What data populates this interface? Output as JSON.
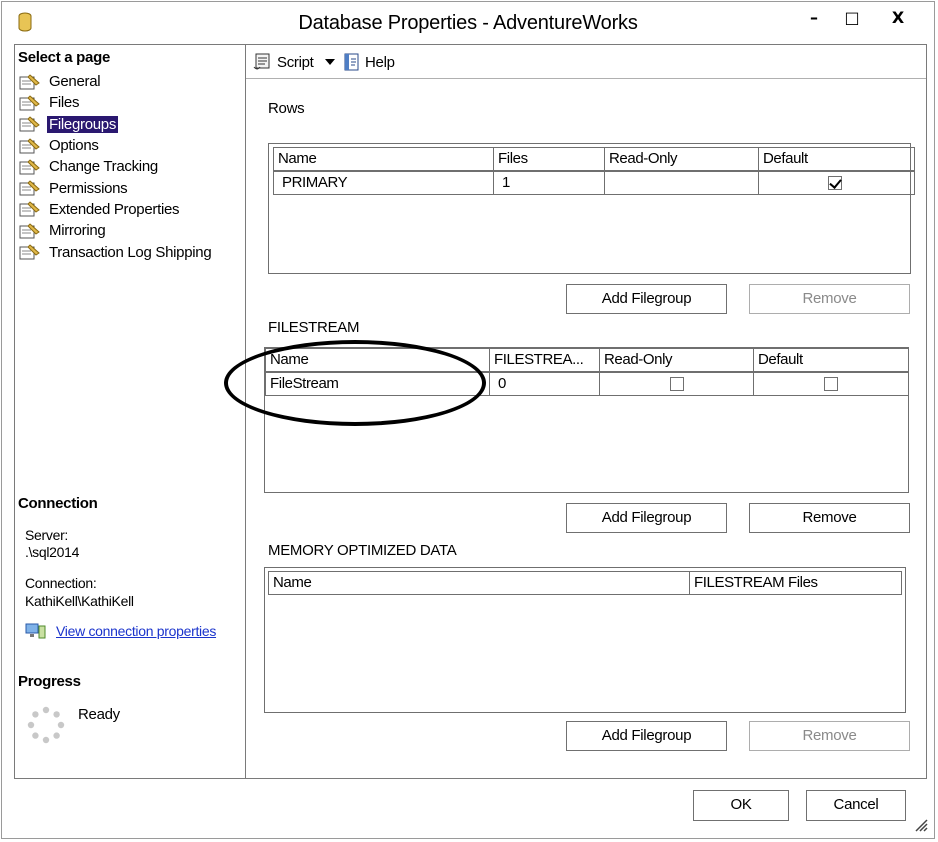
{
  "window": {
    "title": "Database Properties - AdventureWorks",
    "minimize_glyph": "–",
    "maximize_glyph": "□",
    "close_glyph": "X"
  },
  "left": {
    "select_page_heading": "Select a page",
    "pages": [
      {
        "label": "General",
        "selected": false
      },
      {
        "label": "Files",
        "selected": false
      },
      {
        "label": "Filegroups",
        "selected": true
      },
      {
        "label": "Options",
        "selected": false
      },
      {
        "label": "Change Tracking",
        "selected": false
      },
      {
        "label": "Permissions",
        "selected": false
      },
      {
        "label": "Extended Properties",
        "selected": false
      },
      {
        "label": "Mirroring",
        "selected": false
      },
      {
        "label": "Transaction Log Shipping",
        "selected": false
      }
    ],
    "connection_heading": "Connection",
    "server_label": "Server:",
    "server_value": ".\\sql2014",
    "connection_label": "Connection:",
    "connection_value": "KathiKell\\KathiKell",
    "view_connection_link": "View connection properties",
    "progress_heading": "Progress",
    "progress_status": "Ready"
  },
  "toolbar": {
    "script_label": "Script",
    "help_label": "Help"
  },
  "rows": {
    "heading": "Rows",
    "columns": [
      "Name",
      "Files",
      "Read-Only",
      "Default"
    ],
    "items": [
      {
        "name": "PRIMARY",
        "files": "1",
        "read_only": false,
        "default": true
      }
    ],
    "add_button": "Add Filegroup",
    "remove_button": "Remove",
    "remove_enabled": false
  },
  "filestream": {
    "heading": "FILESTREAM",
    "columns": [
      "Name",
      "FILESTREA...",
      "Read-Only",
      "Default"
    ],
    "items": [
      {
        "name": "FileStream",
        "files": "0",
        "read_only": false,
        "default": false
      }
    ],
    "add_button": "Add Filegroup",
    "remove_button": "Remove",
    "remove_enabled": true
  },
  "memory": {
    "heading": "MEMORY OPTIMIZED DATA",
    "columns": [
      "Name",
      "FILESTREAM Files"
    ],
    "add_button": "Add Filegroup",
    "remove_button": "Remove",
    "remove_enabled": false
  },
  "footer": {
    "ok_label": "OK",
    "cancel_label": "Cancel"
  },
  "colors": {
    "selection": "#2a1870",
    "link": "#1a33cc",
    "disabled_text": "#8a8a8a"
  }
}
